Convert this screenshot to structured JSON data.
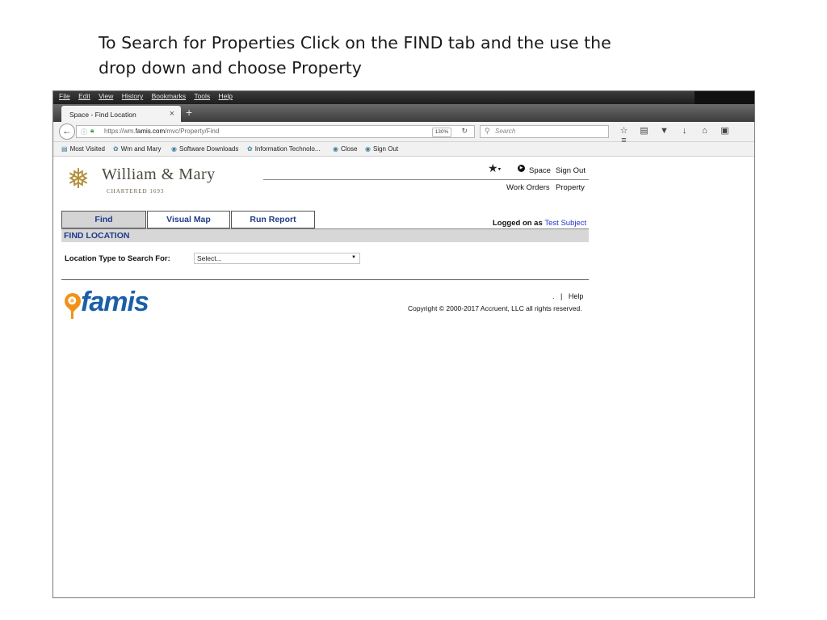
{
  "caption": {
    "line1": "To Search for Properties Click on the FIND tab and the use the",
    "line2": "drop down and choose Property"
  },
  "browser": {
    "menu": [
      "File",
      "Edit",
      "View",
      "History",
      "Bookmarks",
      "Tools",
      "Help"
    ],
    "tab_title": "Space - Find Location",
    "tab_close": "×",
    "new_tab": "+",
    "url_prefix": "https://wm.",
    "url_domain": "famis.com",
    "url_path": "/mvc/Property/Find",
    "zoom": "130%",
    "search_placeholder": "Search",
    "bookmarks": [
      "Most Visited",
      "Wm and Mary",
      "Software Downloads",
      "Information Technolo...",
      "Close",
      "Sign Out"
    ]
  },
  "header": {
    "institution": "William & Mary",
    "chartered": "CHARTERED 1693",
    "space_link": "Space",
    "sign_out": "Sign Out",
    "work_orders": "Work Orders",
    "property": "Property",
    "logged_on_label": "Logged on as",
    "user": "Test Subject"
  },
  "tabs": [
    {
      "label": "Find"
    },
    {
      "label": "Visual Map"
    },
    {
      "label": "Run Report"
    }
  ],
  "section": {
    "title": "FIND LOCATION"
  },
  "form": {
    "location_type_label": "Location Type to Search For:",
    "select_value": "Select..."
  },
  "footer": {
    "brand": "famis",
    "brand_pin_letter": "a",
    "dot": ".",
    "separator": "|",
    "help": "Help",
    "copyright": "Copyright © 2000-2017 Accruent, LLC all rights reserved."
  },
  "colors": {
    "link_blue": "#1f3a8a",
    "user_blue": "#2233cc",
    "famis_blue": "#1a5fa8",
    "famis_orange": "#f0921a",
    "wm_gold": "#b3913c"
  }
}
